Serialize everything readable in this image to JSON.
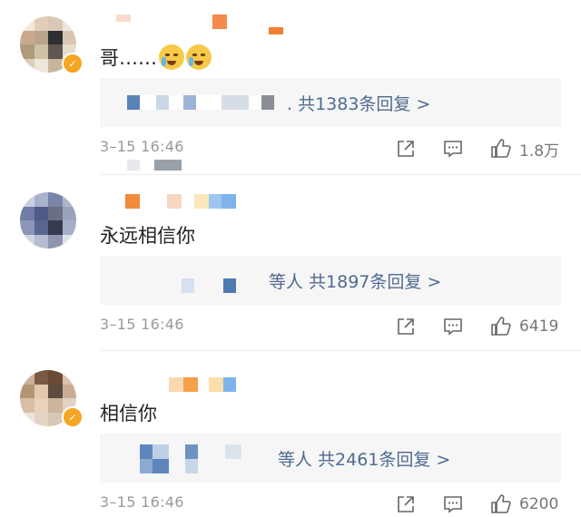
{
  "comments": [
    {
      "text": "哥……",
      "has_emojis": true,
      "emoji_names": [
        "crying-emoji",
        "crying-emoji"
      ],
      "reply_summary": ". 共1383条回复 >",
      "time": "3–15 16:46",
      "like_count": "1.8万",
      "verified": true
    },
    {
      "text": "永远相信你",
      "has_emojis": false,
      "reply_summary": "等人  共1897条回复 >",
      "time": "3–15 16:46",
      "like_count": "6419",
      "verified": false
    },
    {
      "text": "相信你",
      "has_emojis": false,
      "reply_summary": "等人  共2461条回复 >",
      "time": "3–15 16:46",
      "like_count": "6200",
      "verified": true
    }
  ],
  "icons": {
    "share": "share-icon",
    "comment": "comment-icon",
    "like": "thumbs-up-icon",
    "verified": "verified-badge-icon"
  },
  "colors": {
    "reply_link": "#506a90",
    "timestamp": "#999999",
    "verified_badge": "#f5a623",
    "reply_bg": "#f6f6f6"
  }
}
